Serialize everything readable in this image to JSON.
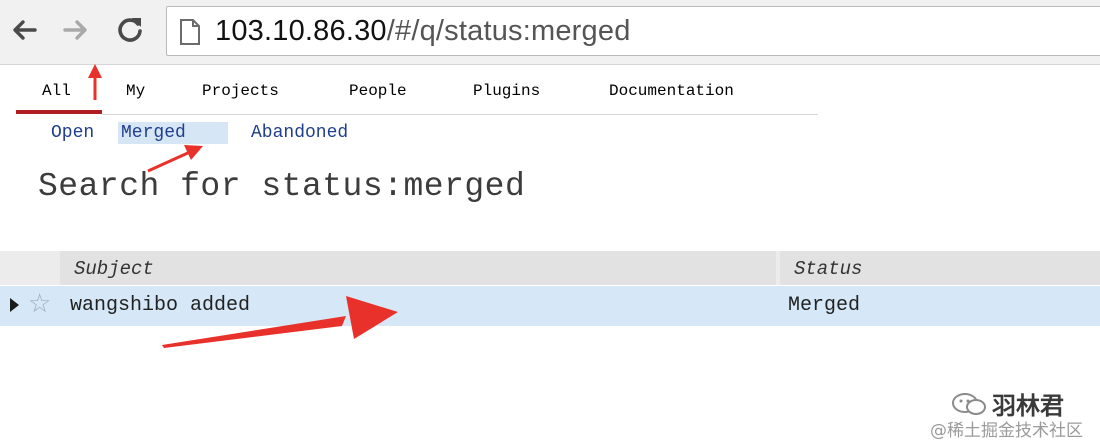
{
  "browser": {
    "url_host": "103.10.86.30",
    "url_path": "/#/q/status:merged"
  },
  "top_nav": {
    "items": [
      {
        "label": "All",
        "active": true
      },
      {
        "label": "My",
        "active": false
      },
      {
        "label": "Projects",
        "active": false
      },
      {
        "label": "People",
        "active": false
      },
      {
        "label": "Plugins",
        "active": false
      },
      {
        "label": "Documentation",
        "active": false
      }
    ]
  },
  "sub_nav": {
    "items": [
      {
        "label": "Open",
        "selected": false
      },
      {
        "label": "Merged",
        "selected": true
      },
      {
        "label": "Abandoned",
        "selected": false
      }
    ]
  },
  "page": {
    "title": "Search for status:merged"
  },
  "table": {
    "columns": [
      "Subject",
      "Status"
    ],
    "rows": [
      {
        "subject": "wangshibo added",
        "status": "Merged"
      }
    ]
  },
  "watermark": {
    "brand": "羽林君",
    "community": "@稀土掘金技术社区"
  },
  "colors": {
    "active_nav": "#8b1a1a",
    "active_underline": "#b01e1e",
    "link_blue": "#1f3f8f",
    "selected_bg": "#d6e6f5",
    "row_highlight": "#d6e8f7",
    "annotation_arrow": "#e8312a"
  }
}
